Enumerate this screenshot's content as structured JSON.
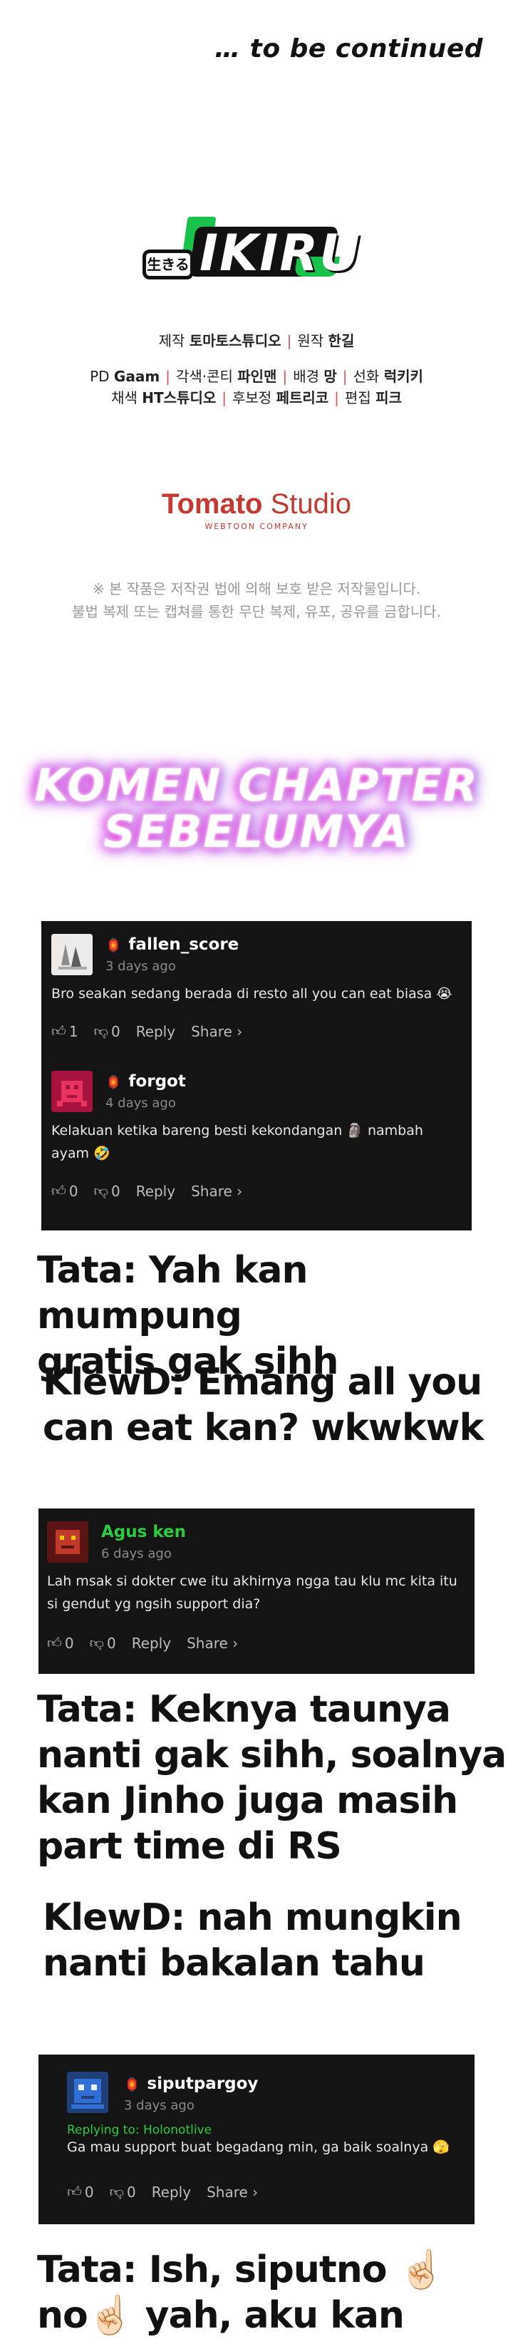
{
  "header": {
    "continued": "… to be continued",
    "logo_tag": "生きる",
    "logo_text": "IKIRU"
  },
  "credits": {
    "line1": {
      "a": "제작 ",
      "a_b": "토마토스튜디오",
      "b": "원작 ",
      "b_b": "한길"
    },
    "line2": {
      "a": "PD ",
      "a_b": "Gaam",
      "b": "각색·콘티 ",
      "b_b": "파인맨",
      "c": "배경 ",
      "c_b": "망",
      "d": "선화 ",
      "d_b": "럭키키"
    },
    "line3": {
      "a": "채색 ",
      "a_b": "HT스튜디오",
      "b": "후보정 ",
      "b_b": "페트리코",
      "c": "편집 ",
      "c_b": "피크"
    }
  },
  "studio": {
    "name_bold": "Tomato",
    "name_light": " Studio",
    "sub": "WEBTOON COMPANY"
  },
  "notice": {
    "line1": "※ 본 작품은 저작권 법에 의해 보호 받은 저작물입니다.",
    "line2": "불법 복제 또는 캡쳐를 통한 무단 복제, 유포, 공유를 금합니다."
  },
  "neon": {
    "line1": "KOMEN CHAPTER",
    "line2": "SEBELUMYA"
  },
  "comments": [
    {
      "user": "fallen_score",
      "badge": "🏮",
      "time": "3 days ago",
      "text": "Bro seakan sedang berada di resto all you can eat biasa 😭",
      "likes": "1",
      "dislikes": "0",
      "reply": "Reply",
      "share": "Share ›",
      "user_color": "#ffffff"
    },
    {
      "user": "forgot",
      "badge": "🏮",
      "time": "4 days ago",
      "text1": "Kelakuan ketika bareng besti kekondangan 🗿 nambah",
      "text2": "ayam 🤣",
      "likes": "0",
      "dislikes": "0",
      "reply": "Reply",
      "share": "Share ›",
      "user_color": "#ffffff"
    },
    {
      "user": "Agus ken",
      "time": "6 days ago",
      "text1": "Lah msak si dokter cwe itu akhirnya ngga tau klu mc kita itu",
      "text2": "si gendut yg ngsih support dia?",
      "likes": "0",
      "dislikes": "0",
      "reply": "Reply",
      "share": "Share ›",
      "user_color": "#2ecc40"
    },
    {
      "user": "siputpargoy",
      "badge": "🏮",
      "time": "3 days ago",
      "reply_to": "Replying to: Holonotlive",
      "text": "Ga mau support buat begadang min, ga baik soalnya 🫣",
      "likes": "0",
      "dislikes": "0",
      "reply": "Reply",
      "share": "Share ›",
      "user_color": "#ffffff"
    }
  ],
  "chat": {
    "t1": [
      "Tata: Yah kan mumpung",
      "gratis gak sihh"
    ],
    "k1": [
      "KlewD: Emang all you",
      "can eat kan? wkwkwk"
    ],
    "t2": [
      "Tata: Keknya taunya",
      "nanti gak sihh, soalnya",
      "kan Jinho juga masih",
      "part time di RS"
    ],
    "k2": [
      "KlewD: nah mungkin",
      "nanti bakalan tahu"
    ],
    "t3": [
      "Tata: Ish, siputno ☝🏻",
      "no☝🏻 yah, aku kan"
    ]
  },
  "colors": {
    "accent_green": "#19c24a",
    "studio_red": "#c33a32",
    "card_bg": "#141414"
  }
}
